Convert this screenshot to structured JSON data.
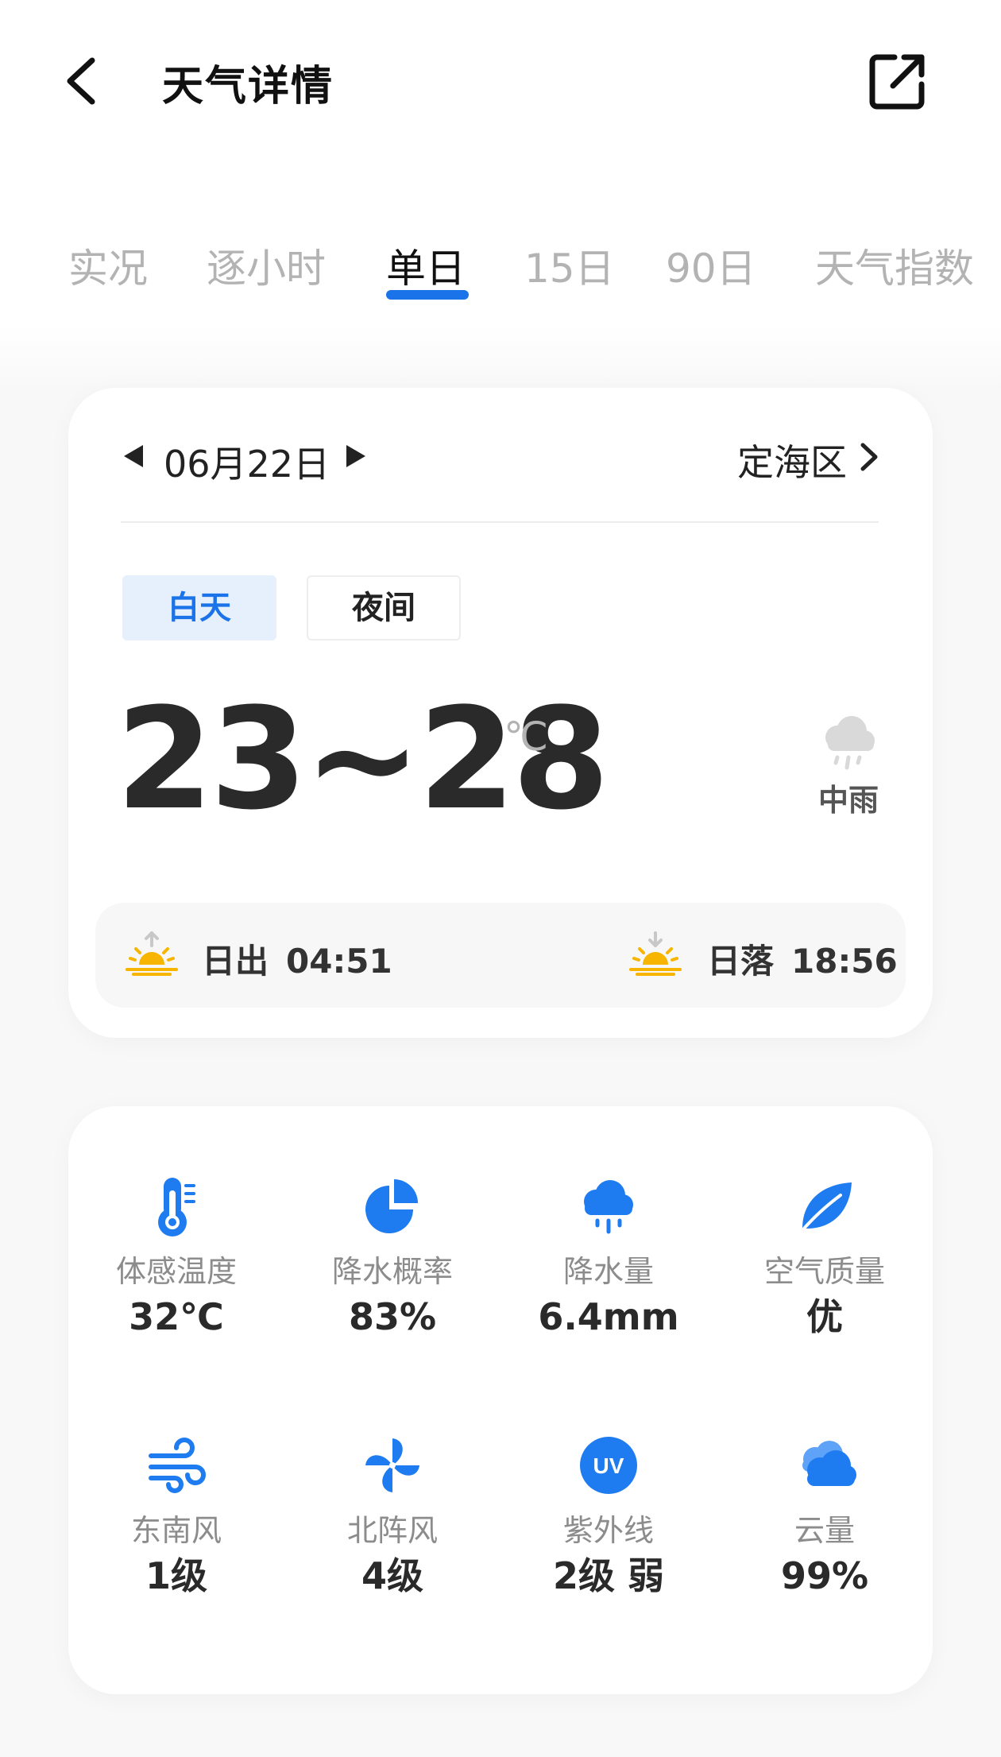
{
  "header": {
    "title": "天气详情",
    "back_icon": "back-arrow-icon",
    "share_icon": "external-link-icon"
  },
  "tabs": [
    {
      "label": "实况",
      "active": false
    },
    {
      "label": "逐小时",
      "active": false
    },
    {
      "label": "单日",
      "active": true
    },
    {
      "label": "15日",
      "active": false
    },
    {
      "label": "90日",
      "active": false
    },
    {
      "label": "天气指数",
      "active": false
    }
  ],
  "day_card": {
    "date": "06月22日",
    "location": "定海区",
    "segments": {
      "day": "白天",
      "night": "夜间",
      "selected": "day"
    },
    "temp_range": "23~28",
    "temp_unit": "℃",
    "weather": "中雨",
    "sunrise": {
      "label": "日出",
      "time": "04:51"
    },
    "sunset": {
      "label": "日落",
      "time": "18:56"
    }
  },
  "details": [
    {
      "icon": "thermometer-icon",
      "label": "体感温度",
      "value": "32℃"
    },
    {
      "icon": "pie-chart-icon",
      "label": "降水概率",
      "value": "83%"
    },
    {
      "icon": "rain-cloud-icon",
      "label": "降水量",
      "value": "6.4mm"
    },
    {
      "icon": "leaf-icon",
      "label": "空气质量",
      "value": "优"
    },
    {
      "icon": "wind-icon",
      "label": "东南风",
      "value": "1级"
    },
    {
      "icon": "pinwheel-icon",
      "label": "北阵风",
      "value": "4级"
    },
    {
      "icon": "uv-icon",
      "label": "紫外线",
      "value": "2级 弱"
    },
    {
      "icon": "cloud-icon",
      "label": "云量",
      "value": "99%"
    }
  ],
  "colors": {
    "accent": "#1a73e8",
    "icon_blue": "#1f7cf0",
    "sun_yellow": "#f7b500",
    "muted_text": "#8c8c8c"
  }
}
